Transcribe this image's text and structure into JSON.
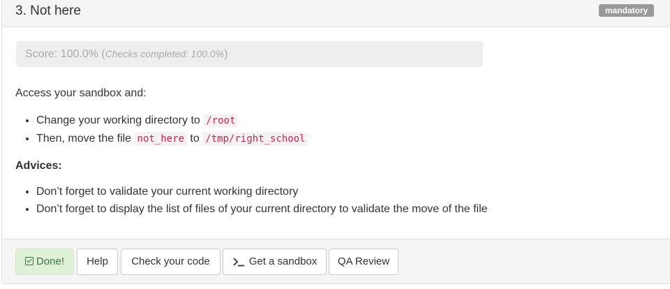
{
  "task": {
    "title": "3. Not here",
    "badge": "mandatory"
  },
  "score": {
    "label": "Score: 100.0% (",
    "checks": "Checks completed: 100.0%",
    "suffix": ")"
  },
  "description": {
    "intro": "Access your sandbox and:",
    "steps": [
      {
        "text": "Change your working directory to ",
        "code": "/root"
      },
      {
        "text": "Then, move the file ",
        "code": "not_here",
        "middle": " to ",
        "code2": "/tmp/right_school"
      }
    ],
    "advices_heading": "Advices:",
    "advices": [
      "Don’t forget to validate your current working directory",
      "Don’t forget to display the list of files of your current directory to validate the move of the file"
    ]
  },
  "footer": {
    "done_label": "Done!",
    "help_label": "Help",
    "check_label": "Check your code",
    "sandbox_label": "Get a sandbox",
    "qa_label": "QA Review",
    "icons": {
      "done": "check-square-icon",
      "sandbox": "terminal-icon"
    }
  },
  "colors": {
    "badge": "#999999",
    "done_bg": "#dff0d8",
    "done_text": "#3c763d",
    "code_text": "#c7254e",
    "code_bg": "#f9f2f4"
  }
}
